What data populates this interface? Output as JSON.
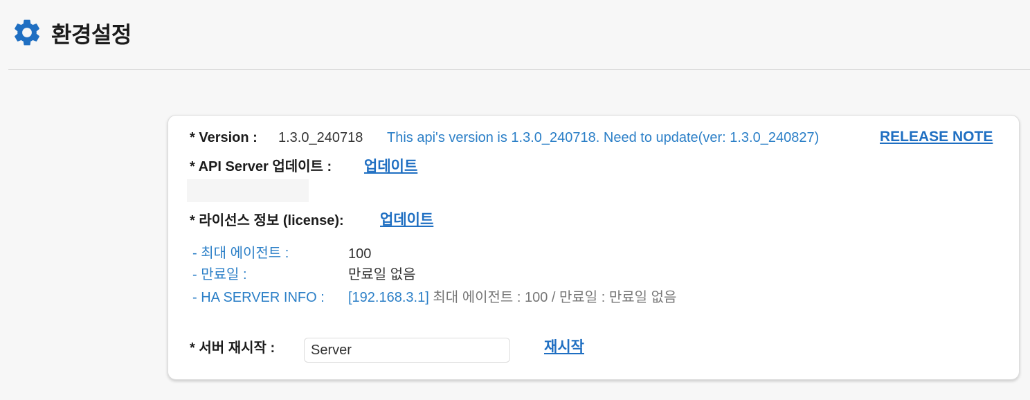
{
  "header": {
    "title": "환경설정",
    "icon": "gear-icon",
    "icon_color": "#1f6fc2"
  },
  "version": {
    "label": "* Version :",
    "value": "1.3.0_240718",
    "notice": "This api's version is 1.3.0_240718. Need to update(ver: 1.3.0_240827)",
    "release_note_link": "RELEASE NOTE"
  },
  "api_server": {
    "label": "* API Server 업데이트 :",
    "update_link": "업데이트"
  },
  "license": {
    "label": "* 라이선스 정보 (license):",
    "update_link": "업데이트",
    "max_agents_label": "- 최대 에이전트 :",
    "max_agents_value": "100",
    "expiry_label": "- 만료일 :",
    "expiry_value": "만료일 없음",
    "ha_label": "- HA SERVER INFO :",
    "ha_ip": "[192.168.3.1]",
    "ha_detail": " 최대 에이전트 : 100 / 만료일 : 만료일 없음"
  },
  "restart": {
    "label": "* 서버 재시작 :",
    "input_value": "Server",
    "restart_link": "재시작"
  },
  "colors": {
    "accent": "#1f6fc2",
    "info_text": "#2b7fc7",
    "muted_text": "#777777",
    "background": "#f7f7f7",
    "card": "#ffffff"
  }
}
